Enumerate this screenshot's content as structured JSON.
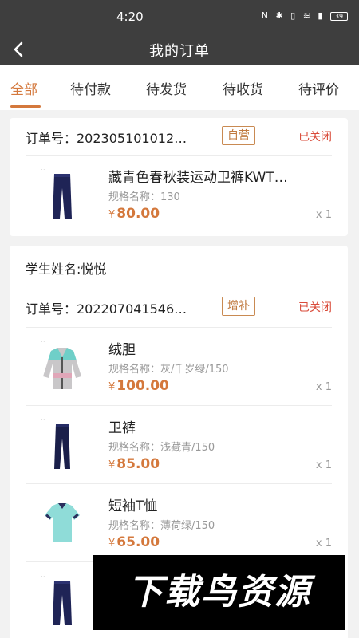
{
  "status_bar": {
    "time": "4:20",
    "icons": "N ✱ ▯ ≋ ▮",
    "battery": "39"
  },
  "nav": {
    "title": "我的订单",
    "back_icon": "chevron-left-icon"
  },
  "tabs": [
    {
      "label": "全部",
      "active": true
    },
    {
      "label": "待付款"
    },
    {
      "label": "待发货"
    },
    {
      "label": "待收货"
    },
    {
      "label": "待评价"
    }
  ],
  "orders": [
    {
      "order_no": "订单号：2023051010​12…",
      "tag": "自营",
      "status": "已关闭",
      "items": [
        {
          "name": "藏青色春秋装运动卫裤KWT…",
          "spec": "规格名称：130",
          "price": "80.00",
          "qty": "x 1",
          "image": "navy-pants"
        }
      ]
    },
    {
      "student": "学生姓名:悦悦",
      "order_no": "订单号：202207041546…",
      "tag": "增补",
      "status": "已关闭",
      "items": [
        {
          "name": "绒胆",
          "spec": "规格名称：灰/千岁绿/150",
          "price": "100.00",
          "qty": "x 1",
          "image": "jacket"
        },
        {
          "name": "卫裤",
          "spec": "规格名称：浅藏青/150",
          "price": "85.00",
          "qty": "x 1",
          "image": "navy-pants"
        },
        {
          "name": "短袖T恤",
          "spec": "规格名称：薄荷绿/150",
          "price": "65.00",
          "qty": "x 1",
          "image": "polo"
        },
        {
          "name": "",
          "spec": "",
          "price": "",
          "qty": "",
          "image": "navy-pants"
        }
      ]
    }
  ],
  "currency": "¥",
  "watermark": "下载鸟资源",
  "colors": {
    "accent": "#d4783c",
    "status_closed": "#d94b3a",
    "nav_bg": "#3e3e3e"
  }
}
